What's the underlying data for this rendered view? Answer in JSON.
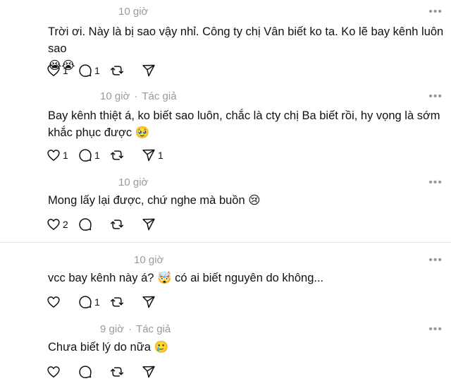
{
  "replies": [
    {
      "time": "10 giờ",
      "author_tag": "",
      "text": "Trời ơi. Này là bị sao vậy nhỉ. Công ty chị Vân biết ko ta. Ko lẽ bay kênh luôn sao\n😭😭",
      "likes": "1",
      "comments": "1",
      "reposts": "",
      "shares": ""
    },
    {
      "time": "10 giờ",
      "author_tag": "Tác giả",
      "text": "Bay kênh thiệt á, ko biết sao luôn, chắc là cty chị Ba biết rồi, hy vọng là sớm\nkhắc phục được 🥹",
      "likes": "1",
      "comments": "1",
      "reposts": "",
      "shares": "1"
    },
    {
      "time": "10 giờ",
      "author_tag": "",
      "text": "Mong lấy lại được, chứ nghe mà buồn 😢",
      "likes": "2",
      "comments": "",
      "reposts": "",
      "shares": ""
    },
    {
      "time": "10 giờ",
      "author_tag": "",
      "text": "vcc bay kênh này á? 🤯 có ai biết nguyên do không...",
      "likes": "",
      "comments": "1",
      "reposts": "",
      "shares": ""
    },
    {
      "time": "9 giờ",
      "author_tag": "Tác giả",
      "text": "Chưa biết lý do nữa 🥲",
      "likes": "",
      "comments": "",
      "reposts": "",
      "shares": ""
    }
  ],
  "icons": {
    "like": "heart-icon",
    "comment": "comment-bubble-icon",
    "repost": "repost-icon",
    "share": "share-send-icon",
    "more": "more-options-icon"
  }
}
